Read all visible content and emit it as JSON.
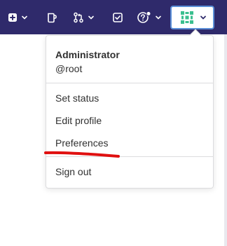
{
  "topbar": {
    "background": "#2f2a6b",
    "items": [
      {
        "icon": "plus-square-icon"
      },
      {
        "icon": "todo-document-icon"
      },
      {
        "icon": "merge-request-icon"
      },
      {
        "icon": "checkbox-icon"
      },
      {
        "icon": "help-icon"
      }
    ],
    "avatar_icon": "avatar-icon"
  },
  "user_menu": {
    "name": "Administrator",
    "username": "@root",
    "items": [
      "Set status",
      "Edit profile",
      "Preferences"
    ],
    "sign_out": "Sign out"
  },
  "annotation": {
    "color": "#e01010",
    "target": "Preferences"
  }
}
